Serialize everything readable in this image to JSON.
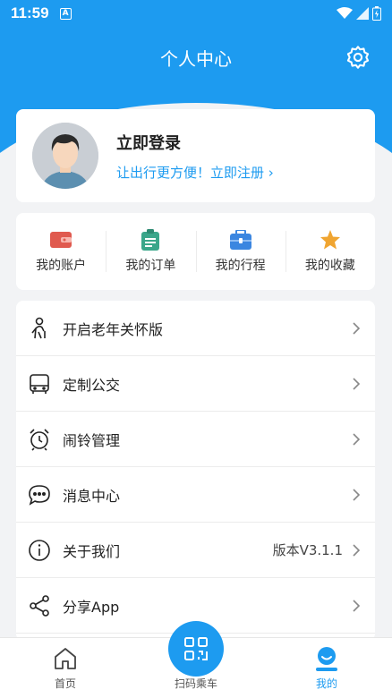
{
  "status": {
    "time": "11:59",
    "notif_icon": "A"
  },
  "header": {
    "title": "个人中心",
    "settings_icon": "gear-icon"
  },
  "login": {
    "title": "立即登录",
    "subtitle": "让出行更方便！立即注册 ›",
    "avatar_icon": "user-avatar"
  },
  "quick_actions": [
    {
      "label": "我的账户",
      "icon": "wallet-icon",
      "color": "#e05a4f"
    },
    {
      "label": "我的订单",
      "icon": "clipboard-icon",
      "color": "#3aa68a"
    },
    {
      "label": "我的行程",
      "icon": "briefcase-icon",
      "color": "#3b86e0"
    },
    {
      "label": "我的收藏",
      "icon": "star-icon",
      "color": "#f0a531"
    }
  ],
  "menu": [
    {
      "label": "开启老年关怀版",
      "icon": "elder-icon"
    },
    {
      "label": "定制公交",
      "icon": "bus-icon"
    },
    {
      "label": "闹铃管理",
      "icon": "alarm-clock-icon"
    },
    {
      "label": "消息中心",
      "icon": "chat-bubble-icon"
    },
    {
      "label": "关于我们",
      "icon": "info-icon",
      "value": "版本V3.1.1"
    },
    {
      "label": "分享App",
      "icon": "share-icon"
    }
  ],
  "tabbar": {
    "items": [
      {
        "label": "首页",
        "icon": "home-icon"
      },
      {
        "label": "扫码乘车",
        "icon": "qr-scan-icon"
      },
      {
        "label": "我的",
        "icon": "profile-icon",
        "active": true
      }
    ],
    "accent": "#1d9bf0"
  }
}
